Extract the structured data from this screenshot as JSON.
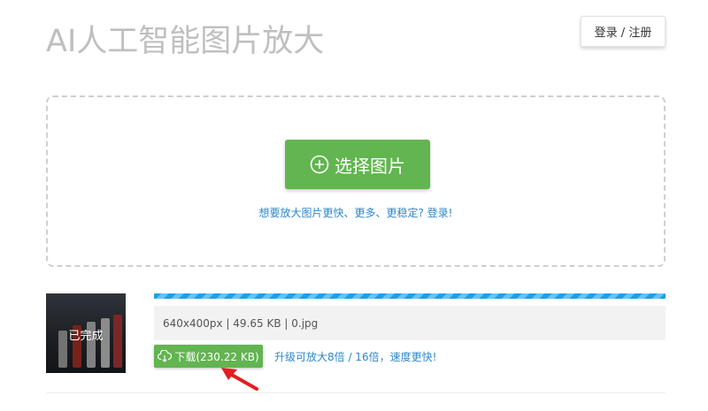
{
  "header": {
    "title": "AI人工智能图片放大",
    "login_label": "登录 / 注册"
  },
  "upload": {
    "select_label": "选择图片",
    "promo_text": "想要放大图片更快、更多、更稳定? 登录!"
  },
  "result": {
    "thumbnail_status": "已完成",
    "progress": 1.0,
    "file_info": "640x400px | 49.65 KB | 0.jpg",
    "download_label": "下载(230.22 KB)",
    "upgrade_text": "升级可放大8倍 / 16倍，速度更快!"
  },
  "colors": {
    "accent_green": "#62b550",
    "link_blue": "#2d87c8",
    "progress_blue": "#1ea0e6",
    "arrow_red": "#e02020",
    "title_gray": "#bfbfbf"
  },
  "icons": {
    "select": "plus-circle-icon",
    "download": "cloud-download-icon",
    "annotation": "red-arrow-icon"
  }
}
